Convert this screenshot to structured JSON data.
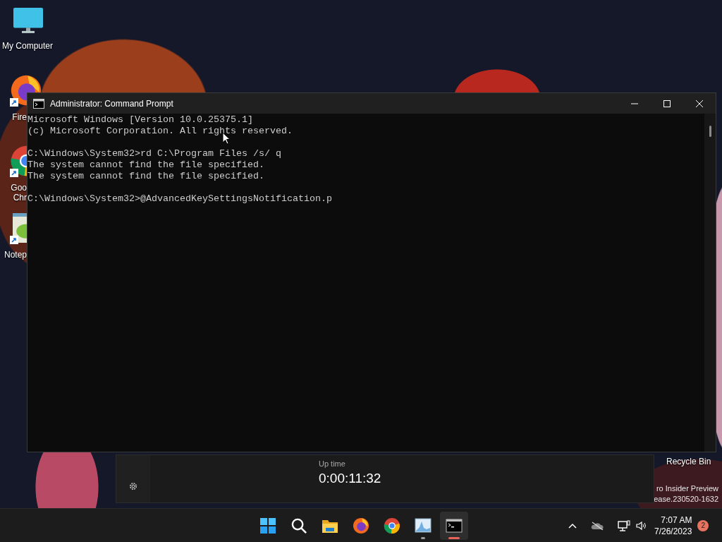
{
  "desktop_icons": [
    {
      "kind": "monitor",
      "shortcut": false,
      "label": [
        "My Computer"
      ]
    },
    {
      "kind": "firefox",
      "shortcut": true,
      "label": [
        "Fire"
      ]
    },
    {
      "kind": "chrome",
      "shortcut": true,
      "label": [
        "Goo",
        "Chr"
      ]
    },
    {
      "kind": "notepad",
      "shortcut": true,
      "label": [
        "Notep"
      ]
    }
  ],
  "window": {
    "title": "Administrator: Command Prompt",
    "blocks": [
      [
        "Microsoft Windows [Version 10.0.25375.1]",
        "(c) Microsoft Corporation. All rights reserved."
      ],
      [
        "C:\\Windows\\System32>rd C:\\Program Files /s/ q",
        "The system cannot find the file specified.",
        "The system cannot find the file specified."
      ],
      [
        "C:\\Windows\\System32>@AdvancedKeySettingsNotification.p"
      ]
    ]
  },
  "uptime_panel": {
    "label": "Up time",
    "value": "0:00:11:32"
  },
  "recycle_bin": {
    "label": "Recycle Bin"
  },
  "desktop_watermark": [
    "ro Insider Preview",
    "ease.230520-1632"
  ],
  "taskbar": {
    "apps": [
      {
        "kind": "start",
        "running": false,
        "selected": false
      },
      {
        "kind": "search",
        "running": false,
        "selected": false
      },
      {
        "kind": "folder",
        "running": false,
        "selected": false
      },
      {
        "kind": "firefox",
        "running": false,
        "selected": false
      },
      {
        "kind": "chrome",
        "running": false,
        "selected": false
      },
      {
        "kind": "chart",
        "running": true,
        "selected": false
      },
      {
        "kind": "terminal",
        "running": true,
        "selected": true
      }
    ],
    "time": "7:07 AM",
    "date": "7/26/2023",
    "notification_count": "2"
  }
}
